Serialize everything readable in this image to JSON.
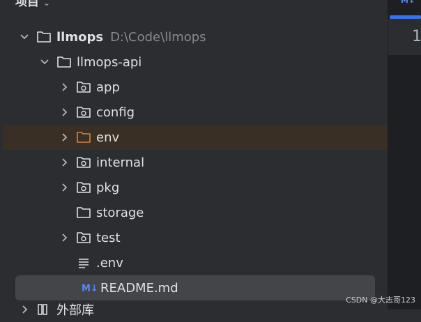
{
  "panel": {
    "title": "项目",
    "dropdown_glyph": "⌄"
  },
  "tree": [
    {
      "label": "llmops",
      "path": "D:\\Code\\llmops",
      "expanded": true,
      "icon": "folder-icon"
    },
    {
      "label": "llmops-api",
      "expanded": true,
      "icon": "folder-icon"
    },
    {
      "label": "app",
      "expanded": false,
      "icon": "package-folder-icon"
    },
    {
      "label": "config",
      "expanded": false,
      "icon": "package-folder-icon"
    },
    {
      "label": "env",
      "expanded": false,
      "icon": "excluded-folder-icon"
    },
    {
      "label": "internal",
      "expanded": false,
      "icon": "package-folder-icon"
    },
    {
      "label": "pkg",
      "expanded": false,
      "icon": "package-folder-icon"
    },
    {
      "label": "storage",
      "icon": "folder-icon"
    },
    {
      "label": "test",
      "expanded": false,
      "icon": "package-folder-icon"
    },
    {
      "label": ".env",
      "icon": "text-file-icon"
    },
    {
      "label": "README.md",
      "icon": "markdown-file-icon"
    },
    {
      "label": "外部库",
      "icon": "library-icon"
    }
  ],
  "editor": {
    "tab_label": "M↓",
    "line_number": "1"
  },
  "watermark": "CSDN @大志哥123",
  "colors": {
    "accent": "#3574f0",
    "excluded_folder": "#d3824a",
    "highlight_row": "#3a2f24",
    "selected_row": "#43454a"
  }
}
